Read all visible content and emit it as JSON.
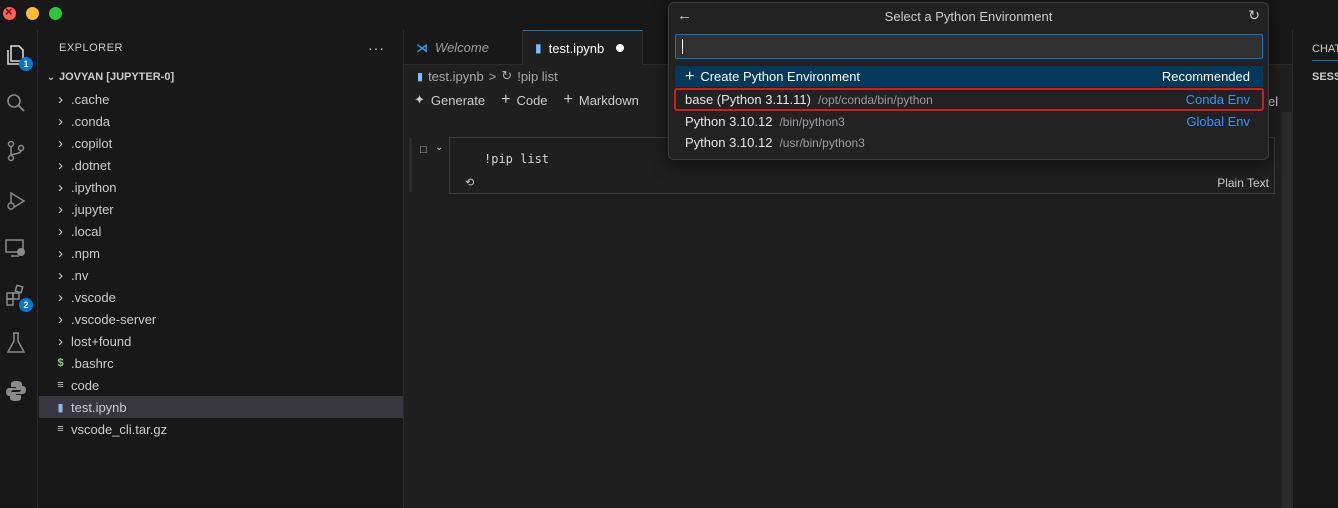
{
  "activity_bar": {
    "explorer_badge": "1",
    "extensions_badge": "2"
  },
  "explorer": {
    "title": "EXPLORER",
    "more": "···",
    "workspace": "JOVYAN [JUPYTER-0]",
    "items": [
      {
        "label": ".cache",
        "kind": "folder"
      },
      {
        "label": ".conda",
        "kind": "folder"
      },
      {
        "label": ".copilot",
        "kind": "folder"
      },
      {
        "label": ".dotnet",
        "kind": "folder"
      },
      {
        "label": ".ipython",
        "kind": "folder"
      },
      {
        "label": ".jupyter",
        "kind": "folder"
      },
      {
        "label": ".local",
        "kind": "folder"
      },
      {
        "label": ".npm",
        "kind": "folder"
      },
      {
        "label": ".nv",
        "kind": "folder"
      },
      {
        "label": ".vscode",
        "kind": "folder"
      },
      {
        "label": ".vscode-server",
        "kind": "folder"
      },
      {
        "label": "lost+found",
        "kind": "folder"
      },
      {
        "label": ".bashrc",
        "kind": "shell"
      },
      {
        "label": "code",
        "kind": "file"
      },
      {
        "label": "test.ipynb",
        "kind": "notebook",
        "selected": true
      },
      {
        "label": "vscode_cli.tar.gz",
        "kind": "file"
      }
    ]
  },
  "tabs": [
    {
      "label": "Welcome"
    },
    {
      "label": "test.ipynb"
    }
  ],
  "breadcrumb": {
    "file": "test.ipynb",
    "separator": ">",
    "cell": "!pip list"
  },
  "toolbar": {
    "generate": "Generate",
    "code": "Code",
    "markdown": "Markdown",
    "kernel_fragment": "el"
  },
  "cell": {
    "source": "!pip list",
    "language": "Plain Text"
  },
  "right_panel": {
    "tab": "CHAT",
    "section": "SESSIONS"
  },
  "quick_pick": {
    "title": "Select a Python Environment",
    "input_value": "",
    "create": {
      "label": "Create Python Environment",
      "detail": "Recommended"
    },
    "options": [
      {
        "label": "base (Python 3.11.11)",
        "path": "/opt/conda/bin/python",
        "detail": "Conda Env"
      },
      {
        "label": "Python 3.10.12",
        "path": "/bin/python3",
        "detail": "Global Env"
      },
      {
        "label": "Python 3.10.12",
        "path": "/usr/bin/python3",
        "detail": ""
      }
    ]
  },
  "colors": {
    "accent": "#0078d4",
    "focus_row": "#04395e",
    "highlight_outline": "#d61a1a",
    "detail_link": "#3794ff"
  }
}
